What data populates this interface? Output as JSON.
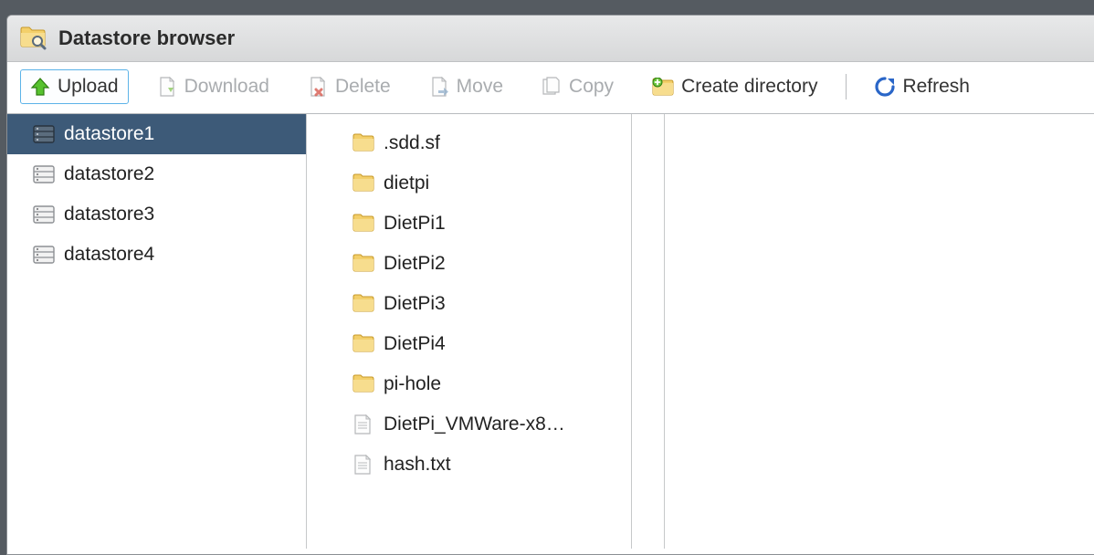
{
  "window": {
    "title": "Datastore browser"
  },
  "toolbar": {
    "upload": {
      "label": "Upload",
      "enabled": true,
      "selected": true
    },
    "download": {
      "label": "Download",
      "enabled": false
    },
    "delete": {
      "label": "Delete",
      "enabled": false
    },
    "move": {
      "label": "Move",
      "enabled": false
    },
    "copy": {
      "label": "Copy",
      "enabled": false
    },
    "createdir": {
      "label": "Create directory",
      "enabled": true
    },
    "refresh": {
      "label": "Refresh",
      "enabled": true
    }
  },
  "datastores": [
    {
      "name": "datastore1",
      "selected": true
    },
    {
      "name": "datastore2",
      "selected": false
    },
    {
      "name": "datastore3",
      "selected": false
    },
    {
      "name": "datastore4",
      "selected": false
    }
  ],
  "contents": [
    {
      "name": ".sdd.sf",
      "type": "folder"
    },
    {
      "name": "dietpi",
      "type": "folder"
    },
    {
      "name": "DietPi1",
      "type": "folder"
    },
    {
      "name": "DietPi2",
      "type": "folder"
    },
    {
      "name": "DietPi3",
      "type": "folder"
    },
    {
      "name": "DietPi4",
      "type": "folder"
    },
    {
      "name": "pi-hole",
      "type": "folder"
    },
    {
      "name": "DietPi_VMWare-x8…",
      "type": "file"
    },
    {
      "name": "hash.txt",
      "type": "file"
    }
  ]
}
